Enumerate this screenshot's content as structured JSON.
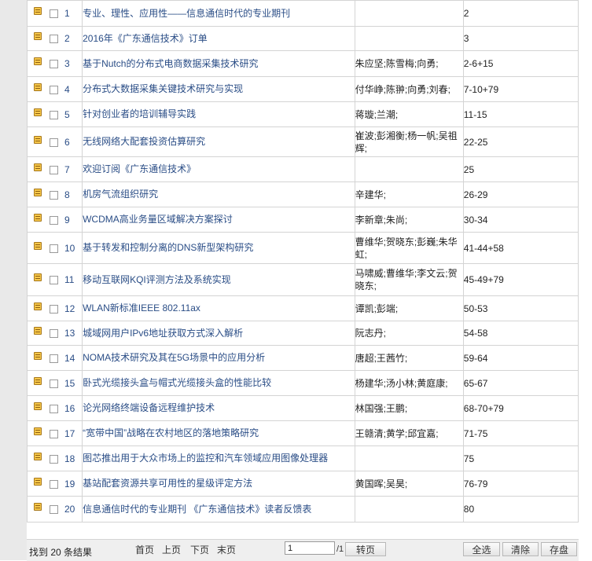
{
  "results": [
    {
      "index": "1",
      "title": "专业、理性、应用性——信息通信时代的专业期刊",
      "author": "",
      "pages": "2"
    },
    {
      "index": "2",
      "title": "2016年《广东通信技术》订单",
      "author": "",
      "pages": "3"
    },
    {
      "index": "3",
      "title": "基于Nutch的分布式电商数据采集技术研究",
      "author": "朱应坚;陈雪梅;向勇;",
      "pages": "2-6+15"
    },
    {
      "index": "4",
      "title": "分布式大数据采集关键技术研究与实现",
      "author": "付华峥;陈翀;向勇;刘春;",
      "pages": "7-10+79"
    },
    {
      "index": "5",
      "title": "针对创业者的培训辅导实践",
      "author": "蒋璇;兰潮;",
      "pages": "11-15"
    },
    {
      "index": "6",
      "title": "无线网络大配套投资估算研究",
      "author": "崔波;彭湘衡;杨一帆;吴祖辉;",
      "pages": "22-25"
    },
    {
      "index": "7",
      "title": "欢迎订阅《广东通信技术》",
      "author": "",
      "pages": "25"
    },
    {
      "index": "8",
      "title": "机房气流组织研究",
      "author": "辛建华;",
      "pages": "26-29"
    },
    {
      "index": "9",
      "title": "WCDMA高业务量区域解决方案探讨",
      "author": "李新章;朱尚;",
      "pages": "30-34"
    },
    {
      "index": "10",
      "title": "基于转发和控制分离的DNS新型架构研究",
      "author": "曹维华;贺晓东;彭巍;朱华虹;",
      "pages": "41-44+58"
    },
    {
      "index": "11",
      "title": "移动互联网KQI评测方法及系统实现",
      "author": "马啸威;曹维华;李文云;贺晓东;",
      "pages": "45-49+79"
    },
    {
      "index": "12",
      "title": "WLAN新标准IEEE 802.11ax",
      "author": "谭凯;彭端;",
      "pages": "50-53"
    },
    {
      "index": "13",
      "title": "城域网用户IPv6地址获取方式深入解析",
      "author": "阮志丹;",
      "pages": "54-58"
    },
    {
      "index": "14",
      "title": "NOMA技术研究及其在5G场景中的应用分析",
      "author": "唐超;王茜竹;",
      "pages": "59-64"
    },
    {
      "index": "15",
      "title": "卧式光缆接头盒与帽式光缆接头盒的性能比较",
      "author": "杨建华;汤小林;黄庭康;",
      "pages": "65-67"
    },
    {
      "index": "16",
      "title": "论光网络终端设备远程维护技术",
      "author": "林国强;王鹏;",
      "pages": "68-70+79"
    },
    {
      "index": "17",
      "title": "“宽带中国”战略在农村地区的落地策略研究",
      "author": "王赣清;黄学;邱宜嘉;",
      "pages": "71-75"
    },
    {
      "index": "18",
      "title": "图芯推出用于大众市场上的监控和汽车领域应用图像处理器",
      "author": "",
      "pages": "75"
    },
    {
      "index": "19",
      "title": "基站配套资源共享可用性的星级评定方法",
      "author": "黄国晖;吴昊;",
      "pages": "76-79"
    },
    {
      "index": "20",
      "title": "信息通信时代的专业期刊 《广东通信技术》读者反馈表",
      "author": "",
      "pages": "80"
    }
  ],
  "footer": {
    "result_count": "找到 20 条结果",
    "first_page": "首页",
    "prev_page": "上页",
    "next_page": "下页",
    "last_page": "末页",
    "page_input_value": "1",
    "page_total": "/1",
    "go_button": "转页",
    "select_all": "全选",
    "clear": "清除",
    "save": "存盘"
  },
  "colors": {
    "link": "#2a4d86",
    "icon_fill": "#f7c84a",
    "border": "#d4d4d4"
  }
}
